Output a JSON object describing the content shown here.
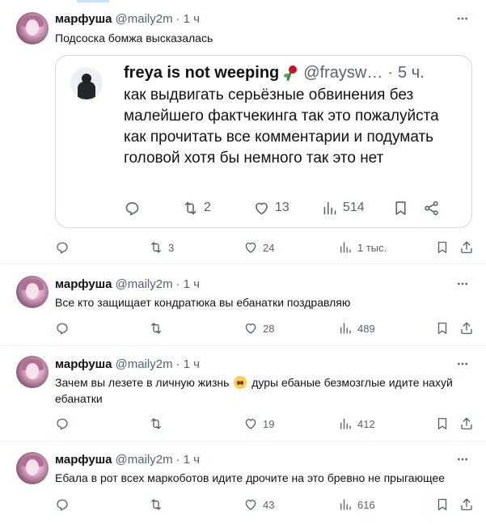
{
  "tweets": [
    {
      "name": "марфуша",
      "handle": "@maily2m",
      "dot": "·",
      "time": "1 ч",
      "text": "Подсоска бомжа высказалась",
      "replies": "",
      "retweets": "3",
      "likes": "24",
      "views": "1 тыс.",
      "quote": {
        "name": "freya is not weeping",
        "handle": "@fraysweeping",
        "handle_display": "@fraysw…",
        "dot": "·",
        "time": "5 ч.",
        "text": "как выдвигать серьёзные обвинения без малейшего фактчекинга так это пожалуйста как прочитать все комментарии и подумать головой хотя бы немного так это нет",
        "replies": "",
        "retweets": "2",
        "likes": "13",
        "views": "514"
      }
    },
    {
      "name": "марфуша",
      "handle": "@maily2m",
      "dot": "·",
      "time": "1 ч",
      "text": "Все кто защищает кондратюка вы ебанатки поздравляю",
      "replies": "",
      "retweets": "",
      "likes": "28",
      "views": "489"
    },
    {
      "name": "марфуша",
      "handle": "@maily2m",
      "dot": "·",
      "time": "1 ч",
      "text_before_emoji": "Зачем вы лезете в личную жизнь ",
      "emoji": "pleading-face-emoji",
      "text_after_emoji": " дуры ебаные безмозглые идите нахуй ебанатки",
      "replies": "",
      "retweets": "",
      "likes": "19",
      "views": "412"
    },
    {
      "name": "марфуша",
      "handle": "@maily2m",
      "dot": "·",
      "time": "1 ч",
      "text": "Ебала в рот всех маркоботов идите дрочите на это бревно не прыгающее",
      "replies": "",
      "retweets": "",
      "likes": "43",
      "views": "616"
    }
  ],
  "icons": {
    "reply": "reply-icon",
    "retweet": "retweet-icon",
    "like": "like-icon",
    "views": "views-icon",
    "bookmark": "bookmark-icon",
    "share": "share-icon",
    "more": "more-icon"
  },
  "colors": {
    "text": "#0f1419",
    "secondary": "#536471",
    "border": "#eff3f4",
    "quote_border": "#cfd9de"
  }
}
